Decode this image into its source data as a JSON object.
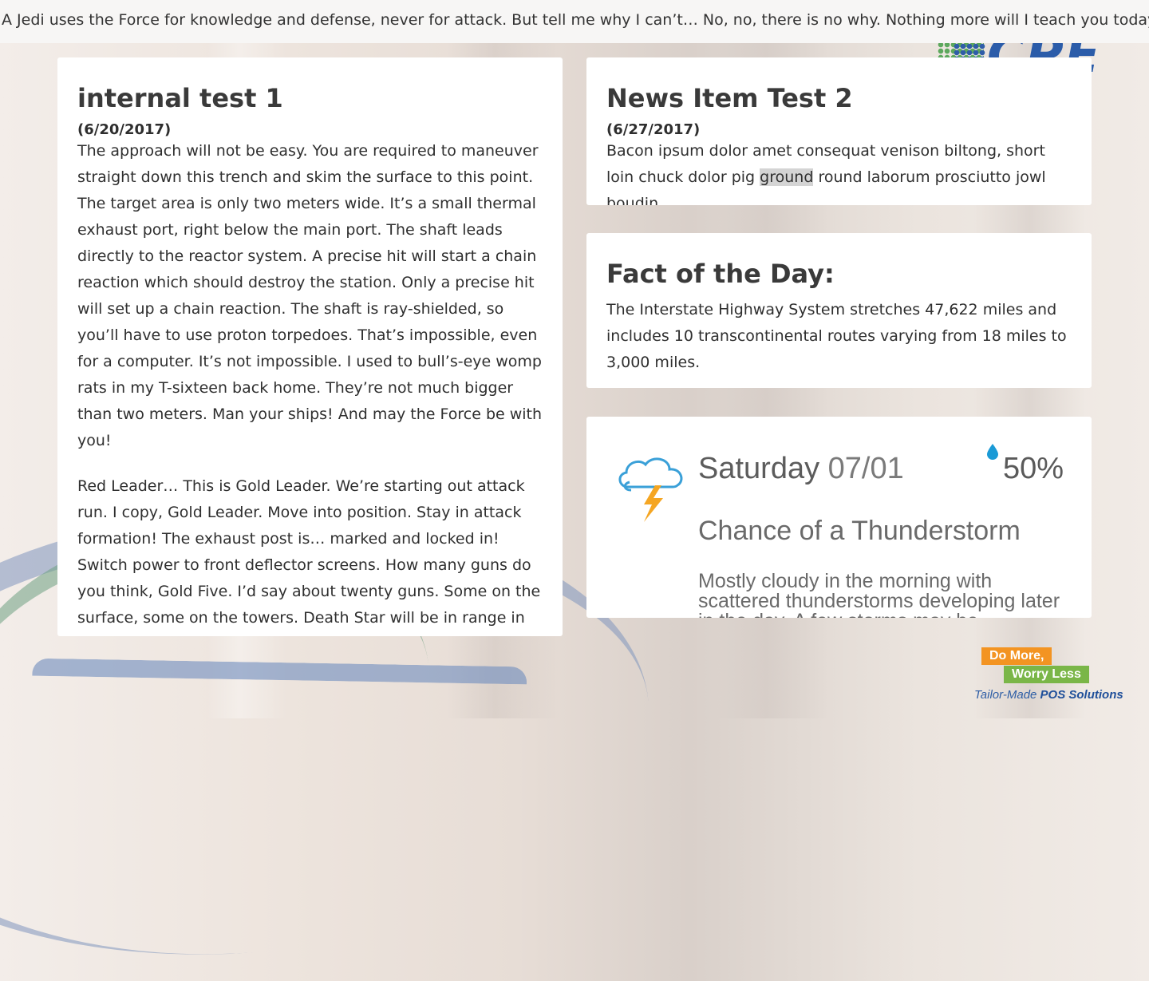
{
  "ticker": {
    "text": "A Jedi uses the Force for knowledge and defense, never for attack. But tell me why I can’t… No, no, there is no why. Nothing more will I teach you today. Clear your mind of questions."
  },
  "logo": {
    "text": "CPE"
  },
  "news": [
    {
      "title": "internal test 1",
      "date": "(6/20/2017)",
      "paragraphs": [
        "The approach will not be easy. You are required to maneuver straight down this trench and skim the surface to this point. The target area is only two meters wide. It’s a small thermal exhaust port, right below the main port. The shaft leads directly to the reactor system. A precise hit will start a chain reaction which should destroy the station. Only a precise hit will set up a chain reaction. The shaft is ray-shielded, so you’ll have to use proton torpedoes. That’s impossible, even for a computer. It’s not impossible. I used to bull’s-eye womp rats in my T-sixteen back home. They’re not much bigger than two meters. Man your ships! And may the Force be with you!",
        "Red Leader… This is Gold Leader. We’re starting out attack run. I copy, Gold Leader. Move into position. Stay in attack formation! The exhaust post is… marked and locked in! Switch power to front deflector screens. How many guns do you think, Gold Five. I’d say about twenty guns. Some on the surface, some on the towers. Death Star will be in range in five minutes. Switching to targeting computer. Computer’s locked. Getting a signal."
      ]
    },
    {
      "title": "News Item Test 2",
      "date": "(6/27/2017)",
      "text_before": "Bacon ipsum dolor amet consequat venison biltong, short loin chuck dolor pig ",
      "highlight": "ground",
      "text_after": " round laborum prosciutto jowl boudin"
    }
  ],
  "fact": {
    "title": "Fact of the Day:",
    "text": "The Interstate Highway System stretches 47,622 miles and includes 10 transcontinental routes varying from 18 miles to 3,000 miles."
  },
  "weather": {
    "icon": "thunderstorm-cloud-icon",
    "day": "Saturday",
    "date": "07/01",
    "precip_icon": "raindrop-icon",
    "precip": "50%",
    "condition": "Chance of a Thunderstorm",
    "description": "Mostly cloudy in the morning with scattered thunderstorms developing later in the day. A few storms may be"
  },
  "promo": {
    "line1": "Do More,",
    "line2": "Worry Less",
    "tag_prefix": "Tailor-Made ",
    "tag_bold": "POS Solutions"
  },
  "colors": {
    "orange": "#f39422",
    "green": "#7ab648",
    "blue": "#2d5da5",
    "lightning": "#f5a623",
    "cloud_outline": "#3aa0d8",
    "drop": "#1a9ad6"
  }
}
